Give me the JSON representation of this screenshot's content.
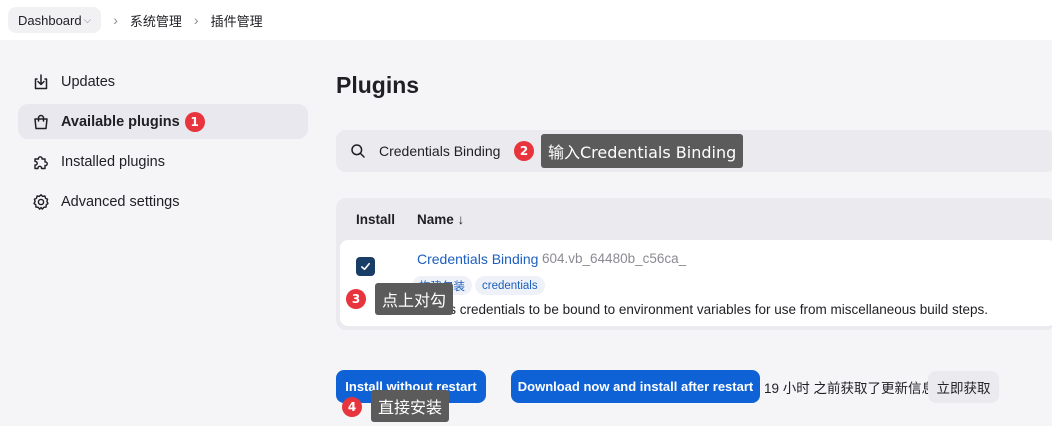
{
  "breadcrumb": {
    "items": [
      "Dashboard",
      "系统管理",
      "插件管理"
    ]
  },
  "sidebar": {
    "items": [
      {
        "label": "Updates",
        "icon": "download-icon",
        "active": false
      },
      {
        "label": "Available plugins",
        "icon": "shopping-bag-icon",
        "active": true
      },
      {
        "label": "Installed plugins",
        "icon": "puzzle-icon",
        "active": false
      },
      {
        "label": "Advanced settings",
        "icon": "gear-icon",
        "active": false
      }
    ]
  },
  "main": {
    "title": "Plugins",
    "search": {
      "value": "Credentials Binding",
      "icon": "search-icon"
    },
    "table": {
      "headers": {
        "install": "Install",
        "name": "Name ↓"
      },
      "rows": [
        {
          "checked": true,
          "name": "Credentials Binding",
          "version": "604.vb_64480b_c56ca_",
          "tags": [
            "构建包装",
            "credentials"
          ],
          "description": "Allows credentials to be bound to environment variables for use from miscellaneous build steps."
        }
      ]
    },
    "actions": {
      "install_without_restart": "Install without restart",
      "download_install_after_restart": "Download now and install after restart",
      "update_info": "19 小时 之前获取了更新信息",
      "fetch_now": "立即获取"
    }
  },
  "annotations": [
    {
      "number": "1"
    },
    {
      "number": "2",
      "text": "输入Credentials Binding"
    },
    {
      "number": "3",
      "text": "点上对勾"
    },
    {
      "number": "4",
      "text": "直接安装"
    }
  ],
  "colors": {
    "accent": "#0f62d6",
    "link": "#1c5fbe",
    "badge": "#e8343c",
    "tooltip": "#5b5b5b",
    "checkbox": "#183d66"
  }
}
